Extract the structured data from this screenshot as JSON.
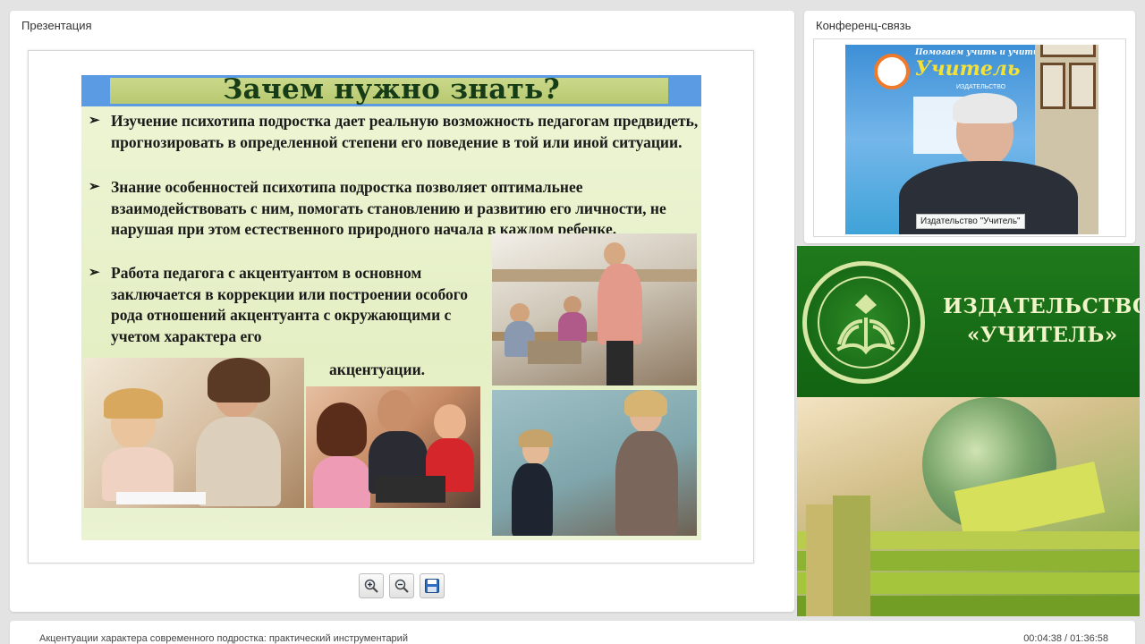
{
  "presentation": {
    "panel_title": "Презентация",
    "slide": {
      "title": "Зачем нужно знать?",
      "bullet_mark": "➢",
      "bullets": [
        "Изучение психотипа подростка  дает реальную возможность педагогам  предвидеть, прогнозировать в определенной степени его поведение в той или иной ситуации.",
        "Знание особенностей психотипа подростка позволяет оптимальнее взаимодействовать с ним, помогать становлению и развитию его личности, не нарушая при этом естественного природного начала в каждом ребенке.",
        "Работа педагога с акцентуантом в основном заключается в коррекции или построении особого рода отношений акцентуанта с окружающими с учетом характера его"
      ],
      "bullet3_tail": "акцентуации."
    },
    "tools": {
      "zoom_in_icon": "zoom-in-icon",
      "zoom_out_icon": "zoom-out-icon",
      "save_icon": "save-icon"
    }
  },
  "conference": {
    "panel_title": "Конференц-связь",
    "video_caption": "Издательство \"Учитель\"",
    "poster_line1": "Помогаем учить и учиться",
    "poster_brand": "Учитель",
    "poster_sub": "ИЗДАТЕЛЬСТВО"
  },
  "banner": {
    "name_line1": "ИЗДАТЕЛЬСТВО",
    "name_line2": "«УЧИТЕЛЬ»"
  },
  "bottom": {
    "course_title": "Акцентуации характера современного подростка: практический инструментарий",
    "time": "00:04:38 / 01:36:58"
  },
  "colors": {
    "slide_header_blue": "#5b9be4",
    "banner_green": "#1f7a1c"
  }
}
